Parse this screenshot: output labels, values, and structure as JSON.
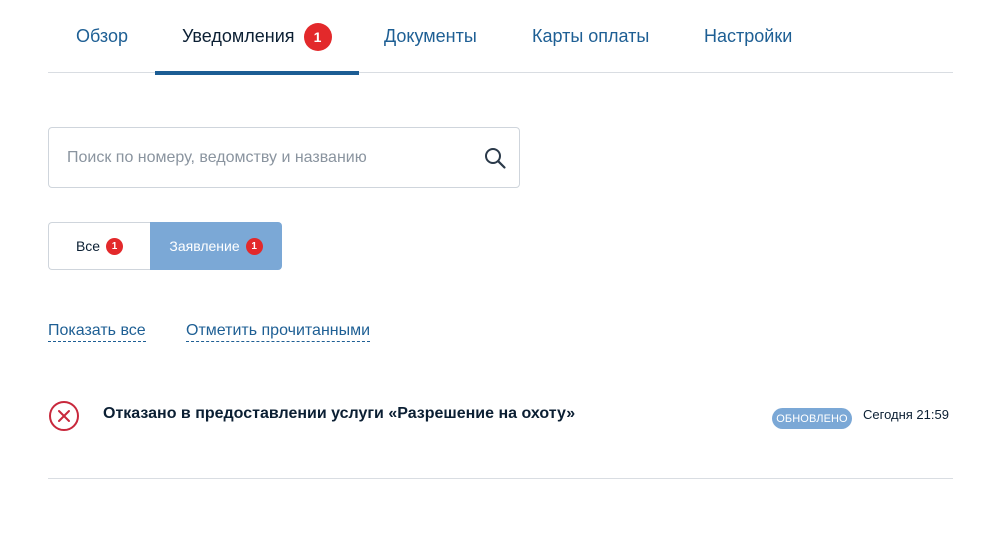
{
  "tabs": [
    {
      "label": "Обзор",
      "active": false
    },
    {
      "label": "Уведомления",
      "active": true,
      "badge": "1"
    },
    {
      "label": "Документы",
      "active": false
    },
    {
      "label": "Карты оплаты",
      "active": false
    },
    {
      "label": "Настройки",
      "active": false
    }
  ],
  "search": {
    "placeholder": "Поиск по номеру, ведомству и названию",
    "value": "",
    "icon": "search-icon"
  },
  "filters": [
    {
      "label": "Все",
      "badge": "1",
      "selected": false
    },
    {
      "label": "Заявление",
      "badge": "1",
      "selected": true
    }
  ],
  "links": {
    "show_all": "Показать все",
    "mark_read": "Отметить прочитанными"
  },
  "notifications": [
    {
      "icon": "error-circle-x-icon",
      "title": "Отказано в предоставлении услуги «Разрешение на охоту»",
      "status": "ОБНОВЛЕНО",
      "time": "Сегодня 21:59"
    }
  ],
  "colors": {
    "accent": "#1c5d94",
    "link": "#1e5f94",
    "badge": "#e3292b",
    "selected_filter": "#7ba8d6",
    "error": "#c8283c"
  }
}
